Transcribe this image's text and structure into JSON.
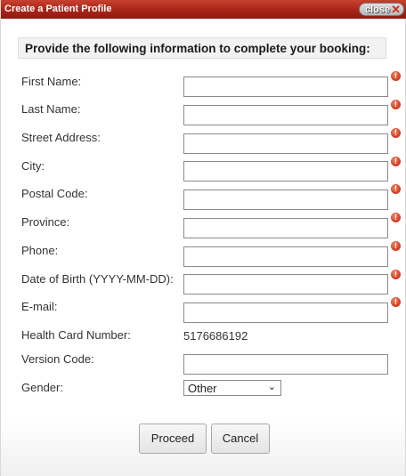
{
  "window": {
    "title": "Create a Patient Profile",
    "close_label": "close",
    "close_icon": "✕"
  },
  "instructions": "Provide the following information to complete your booking:",
  "fields": {
    "first_name": {
      "label": "First Name:",
      "value": ""
    },
    "last_name": {
      "label": "Last Name:",
      "value": ""
    },
    "street_address": {
      "label": "Street Address:",
      "value": ""
    },
    "city": {
      "label": "City:",
      "value": ""
    },
    "postal_code": {
      "label": "Postal Code:",
      "value": ""
    },
    "province": {
      "label": "Province:",
      "value": ""
    },
    "phone": {
      "label": "Phone:",
      "value": ""
    },
    "dob": {
      "label": "Date of Birth (YYYY-MM-DD):",
      "value": ""
    },
    "email": {
      "label": "E-mail:",
      "value": ""
    },
    "health_card": {
      "label": "Health Card Number:",
      "value": "5176686192"
    },
    "version_code": {
      "label": "Version Code:",
      "value": ""
    },
    "gender": {
      "label": "Gender:",
      "value": "Other"
    }
  },
  "required_icon": "!",
  "buttons": {
    "proceed": "Proceed",
    "cancel": "Cancel"
  },
  "colors": {
    "titlebar": "#a82418",
    "required": "#d8452a"
  }
}
